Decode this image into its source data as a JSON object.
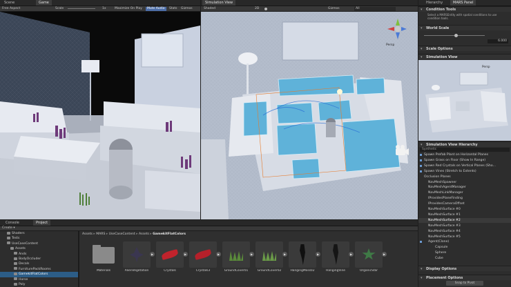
{
  "scene_window": {
    "tabs": [
      "Scene",
      "Game"
    ],
    "toolbar": [
      "Free Aspect",
      "Scale",
      "1x",
      "Maximize On Play",
      "Mute Audio",
      "Stats",
      "Gizmos"
    ],
    "active_toolbar": "Mute Audio"
  },
  "sim_window": {
    "tabs": [
      "Simulation View"
    ],
    "toolbar": [
      "Shaded",
      "2D",
      "Gizmos",
      "All"
    ],
    "persp_label": "Persp"
  },
  "inspector": {
    "tabs": [
      "Hierarchy",
      "MARS Panel"
    ],
    "condition_tools": {
      "title": "Condition Tools",
      "description": "Select a MARSEntity with spatial conditions to use condition tools."
    },
    "world_scale": {
      "title": "World Scale",
      "value": "6.000"
    },
    "scale_options": "Scale Options",
    "simulation_view": {
      "title": "Simulation View",
      "persp_label": "Persp"
    },
    "sim_hierarchy": {
      "title": "Simulation View Hierarchy",
      "search_placeholder": "Synthetic",
      "items": [
        "Spawn Prefab Plant on Horizontal Planes",
        "Spawn Grass on Floor (Show In Range)",
        "Spawn Red Crystals on Vertical Planes (Sho...",
        "Spawn Vines (Stretch to Extents)",
        "Occlusion Planes",
        "NavMeshSpawner",
        "NavMeshAgentManager",
        "NavMeshLinkManager",
        "IProvidesPlaneFinding",
        "IProvidesCameraOffset",
        "NavMeshSurface #0",
        "NavMeshSurface #1",
        "NavMeshSurface #2",
        "NavMeshSurface #3",
        "NavMeshSurface #4",
        "NavMeshSurface #5",
        "Agent(Clone)",
        "Capsule",
        "Sphere",
        "Cube"
      ],
      "selected_index": 12
    },
    "display_options": "Display Options",
    "placement_options": {
      "title": "Placement Options",
      "button": "Snap to Pivot"
    }
  },
  "console": {
    "tabs": [
      "Console",
      "Project"
    ],
    "create_label": "Create ▾",
    "tree": [
      {
        "label": "Shaders",
        "depth": 2
      },
      {
        "label": "Tests",
        "depth": 2
      },
      {
        "label": "UseCaseContent",
        "depth": 2
      },
      {
        "label": "Assets",
        "depth": 3
      },
      {
        "label": "Ands",
        "depth": 4
      },
      {
        "label": "BodyOccluder",
        "depth": 4
      },
      {
        "label": "Decals",
        "depth": 4
      },
      {
        "label": "FurniturePackRooms",
        "depth": 4
      },
      {
        "label": "GamekitFlatColors",
        "depth": 4
      },
      {
        "label": "Horse",
        "depth": 4
      },
      {
        "label": "Poly",
        "depth": 4
      }
    ],
    "selected_tree": "GamekitFlatColors",
    "breadcrumb": [
      "Assets",
      "MARS",
      "UseCaseContent",
      "Assets",
      "GamekitFlatColors"
    ],
    "assets": [
      {
        "label": "Materials",
        "kind": "folder",
        "color": "#8a8a8a"
      },
      {
        "label": "AlienVegetation",
        "kind": "plant",
        "color": "#3a3650"
      },
      {
        "label": "Crystals",
        "kind": "crystal",
        "color": "#c0232c"
      },
      {
        "label": "Crystals3",
        "kind": "crystal",
        "color": "#b5202a"
      },
      {
        "label": "GroundCover01",
        "kind": "grass",
        "color": "#5a8a3a"
      },
      {
        "label": "GroundCover02",
        "kind": "grass",
        "color": "#6a9a48"
      },
      {
        "label": "HangingMoss02",
        "kind": "moss",
        "color": "#101010"
      },
      {
        "label": "HangingVine",
        "kind": "vine",
        "color": "#151515"
      },
      {
        "label": "OrganicStar",
        "kind": "star",
        "color": "#3f7a46"
      }
    ]
  }
}
